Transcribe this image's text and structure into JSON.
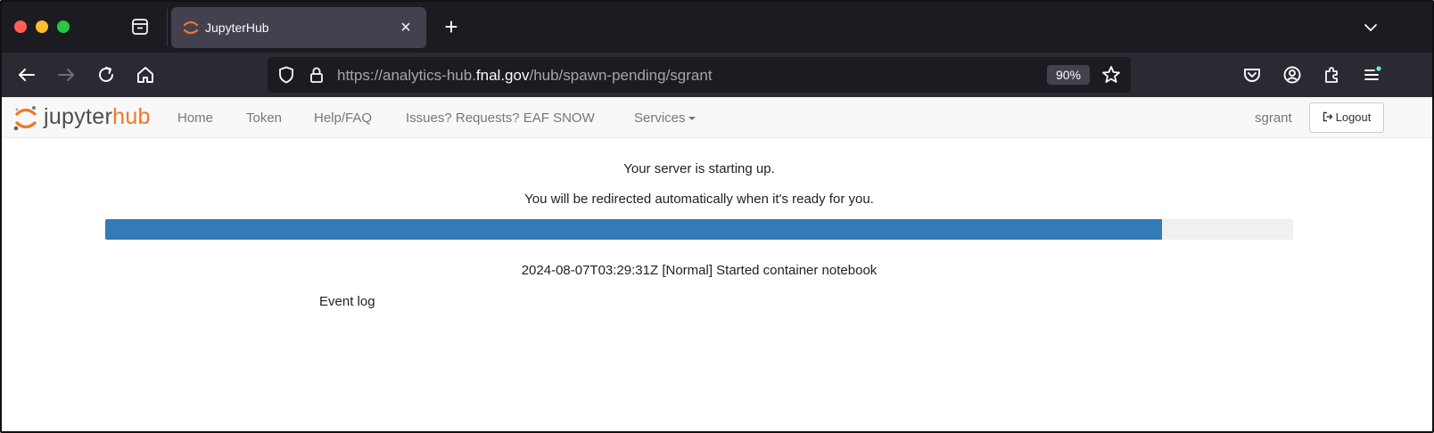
{
  "browser": {
    "tab": {
      "title": "JupyterHub",
      "close_label": "×"
    },
    "new_tab_label": "+",
    "url": {
      "prefix": "https://analytics-hub.",
      "host": "fnal.gov",
      "path": "/hub/spawn-pending/sgrant"
    },
    "zoom": "90%"
  },
  "header": {
    "logo": {
      "part1": "jupyter",
      "part2": "hub"
    },
    "nav": [
      {
        "label": "Home"
      },
      {
        "label": "Token"
      },
      {
        "label": "Help/FAQ"
      },
      {
        "label": "Issues? Requests? EAF SNOW"
      },
      {
        "label": "Services"
      }
    ],
    "user": "sgrant",
    "logout_label": "Logout"
  },
  "main": {
    "status_line1": "Your server is starting up.",
    "status_line2": "You will be redirected automatically when it's ready for you.",
    "progress_percent": 89,
    "event_message": "2024-08-07T03:29:31Z [Normal] Started container notebook",
    "event_log_label": "Event log"
  },
  "colors": {
    "progress": "#337ab7",
    "jupyter_orange": "#f37626",
    "browser_dark": "#1c1b22"
  }
}
